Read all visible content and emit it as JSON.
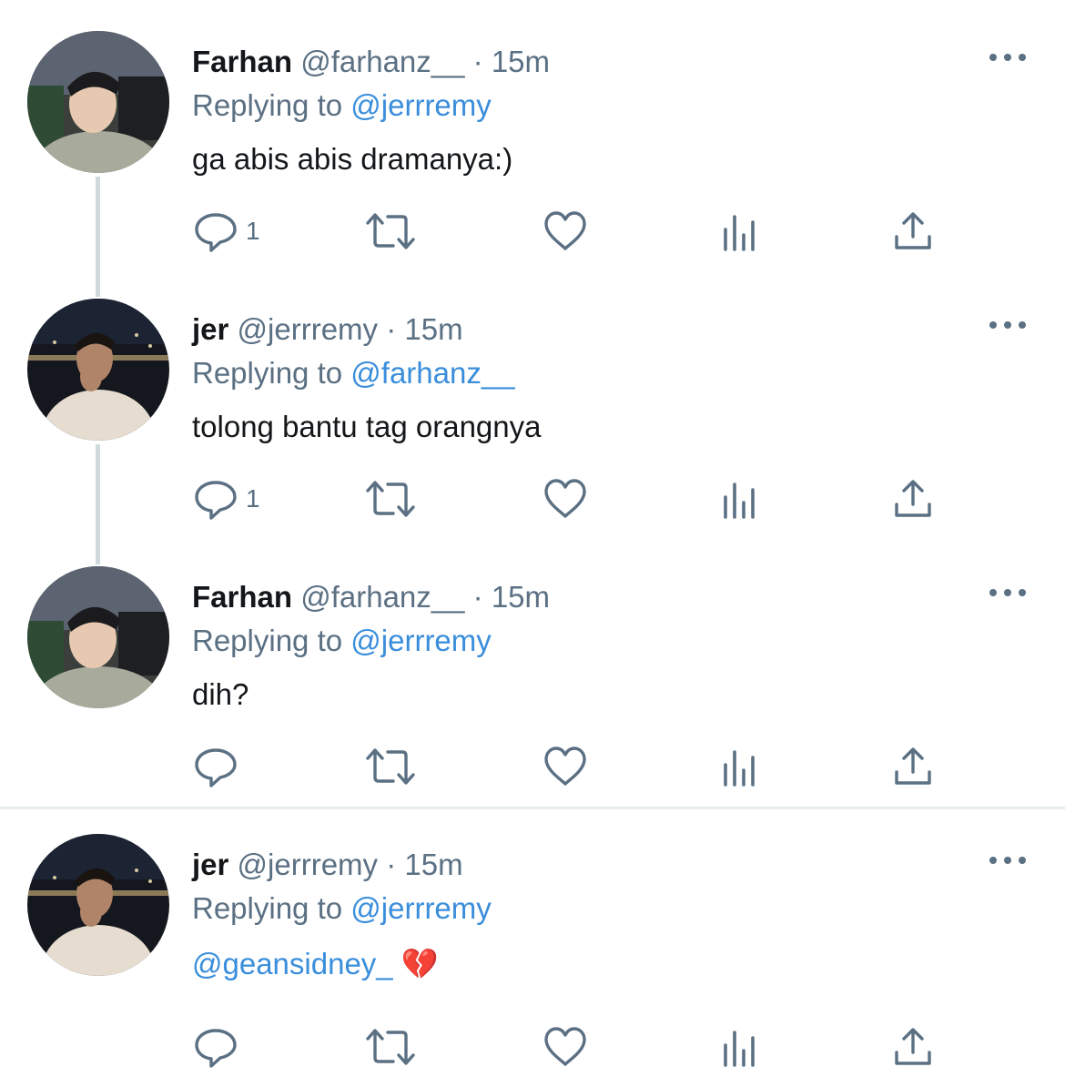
{
  "tweets": [
    {
      "name": "Farhan",
      "handle": "@farhanz__",
      "dot": "·",
      "time": "15m",
      "replying_label": "Replying to",
      "replying_to": "@jerrremy",
      "body_text": "ga abis abis dramanya:)",
      "reply_count": "1",
      "avatar_icon": "farhan-avatar"
    },
    {
      "name": "jer",
      "handle": "@jerrremy",
      "dot": "·",
      "time": "15m",
      "replying_label": "Replying to",
      "replying_to": "@farhanz__",
      "body_text": "tolong bantu tag orangnya",
      "reply_count": "1",
      "avatar_icon": "jer-avatar"
    },
    {
      "name": "Farhan",
      "handle": "@farhanz__",
      "dot": "·",
      "time": "15m",
      "replying_label": "Replying to",
      "replying_to": "@jerrremy",
      "body_text": "dih?",
      "reply_count": "",
      "avatar_icon": "farhan-avatar"
    },
    {
      "name": "jer",
      "handle": "@jerrremy",
      "dot": "·",
      "time": "15m",
      "replying_label": "Replying to",
      "replying_to": "@jerrremy",
      "body_mention": "@geansidney_",
      "body_emoji": "💔",
      "reply_count": "",
      "avatar_icon": "jer-avatar"
    }
  ],
  "icons": [
    "reply-icon",
    "retweet-icon",
    "like-icon",
    "analytics-icon",
    "share-icon",
    "more-icon"
  ],
  "colors": {
    "text": "#14171a",
    "secondary": "#5b7083",
    "link": "#3a8edb",
    "thread_line": "#cfd9de",
    "divider": "#e6ecf0"
  }
}
